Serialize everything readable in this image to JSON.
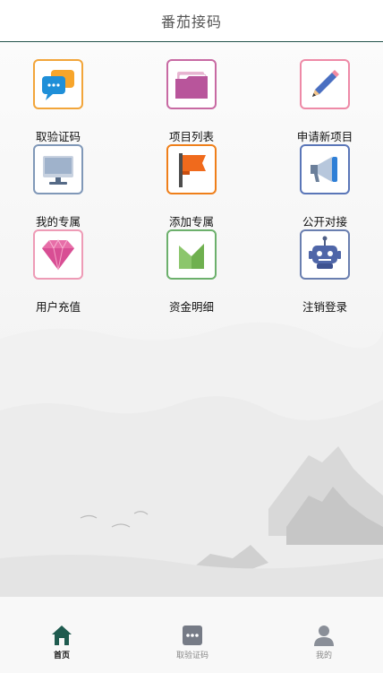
{
  "header": {
    "title": "番茄接码"
  },
  "menu": {
    "items": [
      {
        "label": "取验证码",
        "icon": "chat-bubbles-icon",
        "border": "#f2a53a"
      },
      {
        "label": "项目列表",
        "icon": "folder-icon",
        "border": "#c86aa3"
      },
      {
        "label": "申请新项目",
        "icon": "pencil-icon",
        "border": "#ee8aa7"
      },
      {
        "label": "我的专属",
        "icon": "monitor-icon",
        "border": "#8098b8"
      },
      {
        "label": "添加专属",
        "icon": "flag-icon",
        "border": "#ef7f1a"
      },
      {
        "label": "公开对接",
        "icon": "megaphone-icon",
        "border": "#5a76b8"
      },
      {
        "label": "用户充值",
        "icon": "diamond-icon",
        "border": "#ee9bb6"
      },
      {
        "label": "资金明细",
        "icon": "chart-icon",
        "border": "#6cb06c"
      },
      {
        "label": "注销登录",
        "icon": "robot-icon",
        "border": "#6a7fb0"
      }
    ]
  },
  "tabbar": {
    "home_label": "首页",
    "code_label": "取验证码",
    "mine_label": "我的"
  }
}
